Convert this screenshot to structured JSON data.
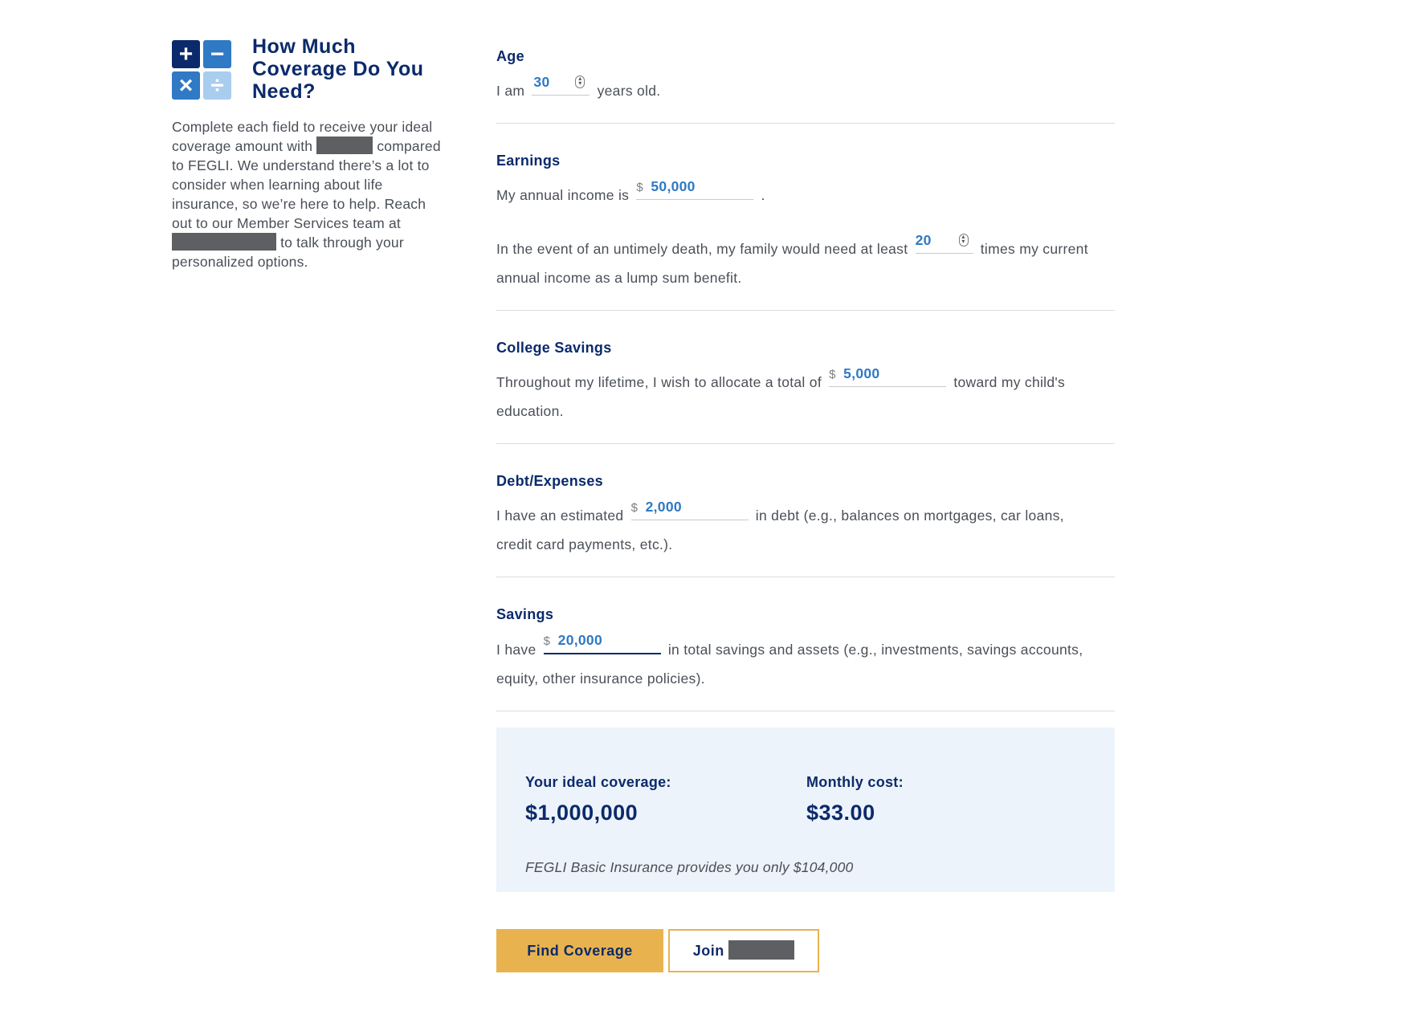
{
  "sidebar": {
    "title": "How Much Coverage Do You Need?",
    "intro_part1": "Complete each field to receive your ideal coverage amount with",
    "intro_part2": "compared to FEGLI. We understand there’s a lot to consider when learning about life insurance, so we’re here to help. Reach out to our Member Services team at",
    "intro_part3": "to talk through your personalized options.",
    "icons": [
      "plus-icon",
      "minus-icon",
      "times-icon",
      "divide-icon"
    ],
    "icon_glyphs": {
      "plus": "+",
      "minus": "−",
      "times": "×",
      "divide": "÷"
    }
  },
  "sections": {
    "age": {
      "label": "Age",
      "prefix": "I am",
      "value": "30",
      "suffix": "years old."
    },
    "earnings": {
      "label": "Earnings",
      "income_prefix": "My annual income is",
      "currency": "$",
      "income_value": "50,000",
      "income_suffix": ".",
      "multiplier_prefix": "In the event of an untimely death, my family would need at least",
      "multiplier_value": "20",
      "multiplier_suffix_line1": "times my current",
      "multiplier_suffix_line2": "annual income as a lump sum benefit."
    },
    "college": {
      "label": "College Savings",
      "prefix": "Throughout my lifetime, I wish to allocate a total of",
      "currency": "$",
      "value": "5,000",
      "suffix_line1": "toward my child's",
      "suffix_line2": "education."
    },
    "debt": {
      "label": "Debt/Expenses",
      "prefix": "I have an estimated",
      "currency": "$",
      "value": "2,000",
      "suffix_line1": "in debt (e.g., balances on mortgages, car loans,",
      "suffix_line2": "credit card payments, etc.)."
    },
    "savings": {
      "label": "Savings",
      "prefix": "I have",
      "currency": "$",
      "value": "20,000",
      "suffix_line1": "in total savings and assets (e.g., investments, savings accounts,",
      "suffix_line2": "equity, other insurance policies)."
    }
  },
  "result": {
    "coverage_label": "Your ideal coverage:",
    "coverage_value": "$1,000,000",
    "cost_label": "Monthly cost:",
    "cost_value": "$33.00",
    "note": "FEGLI Basic Insurance provides you only $104,000"
  },
  "buttons": {
    "find_coverage": "Find Coverage",
    "join": "Join"
  },
  "colors": {
    "navy": "#0b2a6b",
    "blue": "#2f79c5",
    "light_blue": "#a9cdee",
    "gold": "#e8b34f",
    "result_bg": "#edf3fa"
  }
}
